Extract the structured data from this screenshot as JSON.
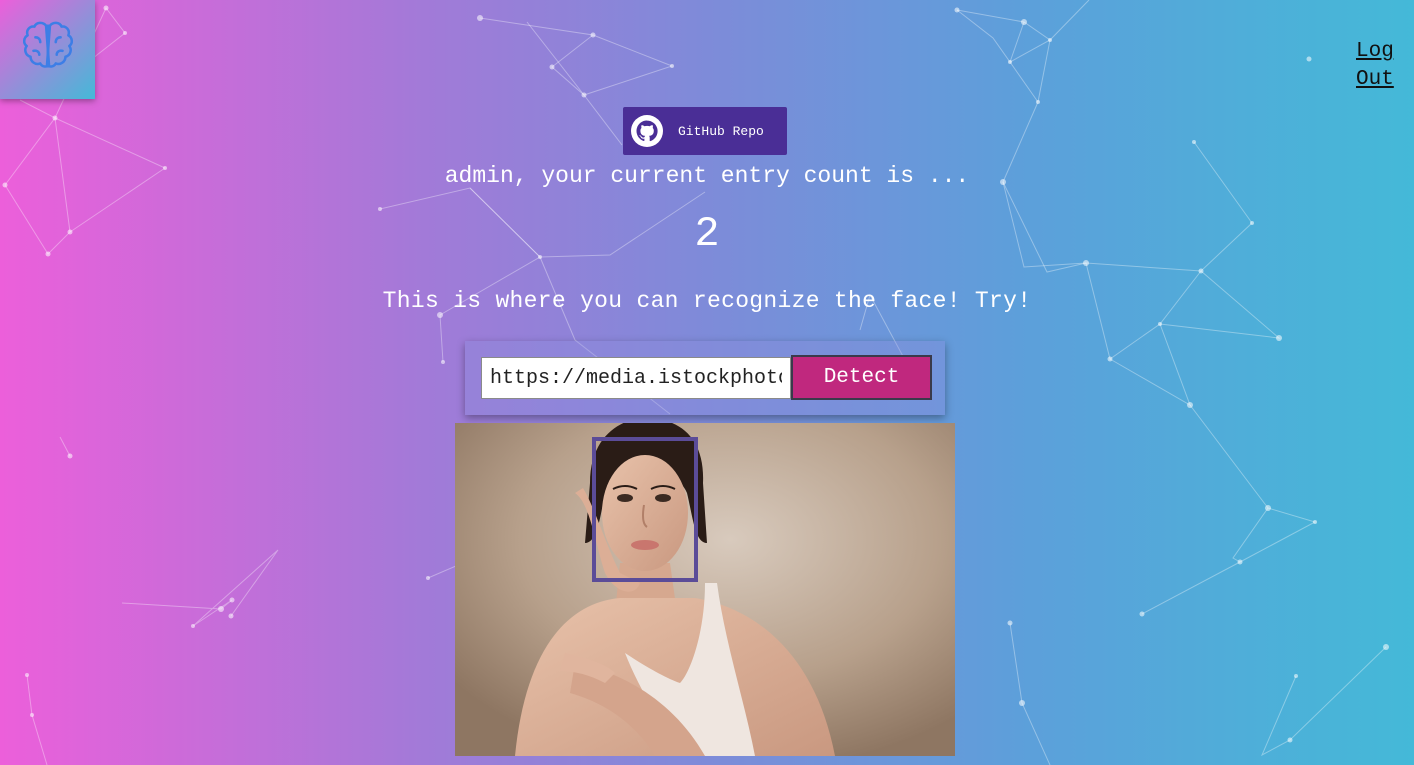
{
  "app": {
    "logo_icon": "brain-icon",
    "logout_label": "Log Out"
  },
  "github": {
    "label": "GitHub Repo",
    "icon": "github-icon",
    "color": "#4a2e96"
  },
  "entry": {
    "message": "admin, your current entry count is ...",
    "count": "2"
  },
  "detector": {
    "tagline": "This is where you can recognize the face! Try!",
    "url_value": "https://media.istockphoto.com/",
    "detect_label": "Detect",
    "detect_color": "#c0287e"
  },
  "result": {
    "image_icon": "portrait-photo",
    "face_box_color": "#5b4c98"
  }
}
